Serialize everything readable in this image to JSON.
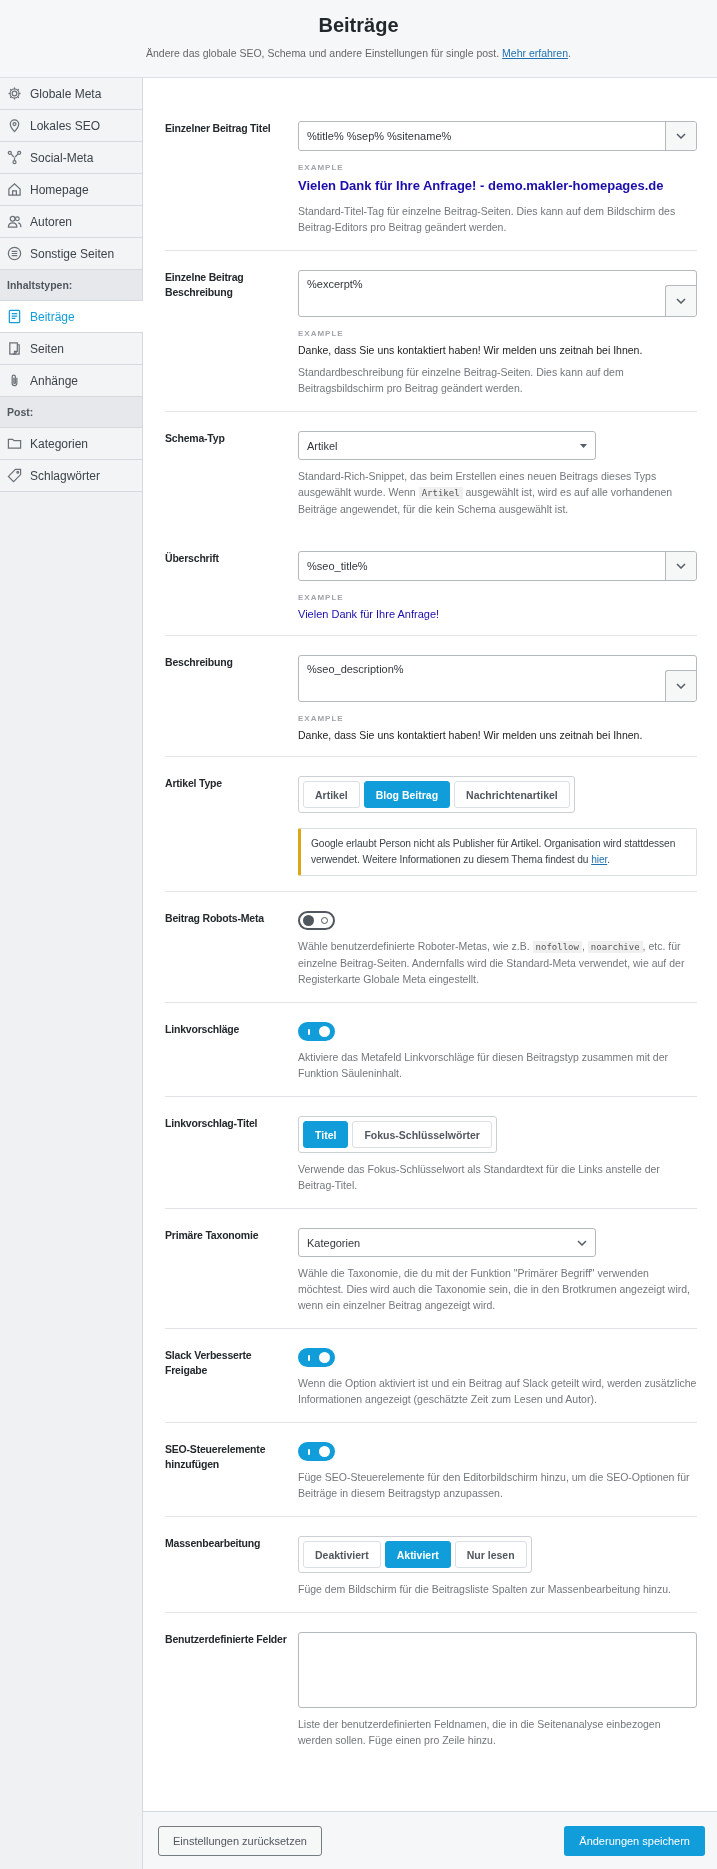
{
  "header": {
    "title": "Beiträge",
    "subtitle": [
      {
        "text": "Ändere das globale SEO, Schema und andere Einstellungen für single post. "
      },
      {
        "text": "Mehr erfahren",
        "link": true
      },
      {
        "text": "."
      }
    ]
  },
  "sidebar": {
    "items": [
      {
        "kind": "item",
        "label": "Globale Meta",
        "selected": false
      },
      {
        "kind": "item",
        "label": "Lokales SEO",
        "selected": false
      },
      {
        "kind": "item",
        "label": "Social-Meta",
        "selected": false
      },
      {
        "kind": "item",
        "label": "Homepage",
        "selected": false
      },
      {
        "kind": "item",
        "label": "Autoren",
        "selected": false
      },
      {
        "kind": "item",
        "label": "Sonstige Seiten",
        "selected": false
      },
      {
        "kind": "heading",
        "label": "Inhaltstypen:"
      },
      {
        "kind": "item",
        "label": "Beiträge",
        "selected": true
      },
      {
        "kind": "item",
        "label": "Seiten",
        "selected": false
      },
      {
        "kind": "item",
        "label": "Anhänge",
        "selected": false
      },
      {
        "kind": "heading",
        "label": "Post:"
      },
      {
        "kind": "item",
        "label": "Kategorien",
        "selected": false
      },
      {
        "kind": "item",
        "label": "Schlagwörter",
        "selected": false
      }
    ]
  },
  "settings": [
    {
      "kind": "template",
      "label": "Einzelner Beitrag Titel",
      "value": "%title% %sep% %sitename%",
      "multiline": false,
      "example_label": "EXAMPLE",
      "example": {
        "kind": "title",
        "text": "Vielen Dank für Ihre Anfrage! - demo.makler-homepages.de"
      },
      "description": [
        {
          "text": "Standard-Titel-Tag für einzelne Beitrag-Seiten. Dies kann auf dem Bildschirm des Beitrag-Editors pro Beitrag geändert werden."
        }
      ],
      "divider": true
    },
    {
      "kind": "template",
      "label": "Einzelne Beitrag Beschreibung",
      "value": "%excerpt%",
      "multiline": true,
      "example_label": "EXAMPLE",
      "example": {
        "kind": "snippet",
        "text": "Danke, dass Sie uns kontaktiert haben! Wir melden uns zeitnah bei Ihnen."
      },
      "description": [
        {
          "text": "Standardbeschreibung für einzelne Beitrag-Seiten. Dies kann auf dem Beitragsbildschirm pro Beitrag geändert werden."
        }
      ],
      "divider": true
    },
    {
      "kind": "select",
      "label": "Schema-Typ",
      "value": "Artikel",
      "description": [
        {
          "text": "Standard-Rich-Snippet, das beim Erstellen eines neuen Beitrags dieses Typs ausgewählt wurde. Wenn "
        },
        {
          "text": "Artikel",
          "code": true
        },
        {
          "text": " ausgewählt ist, wird es auf alle vorhandenen Beiträge angewendet, für die kein Schema ausgewählt ist."
        }
      ],
      "divider": false
    },
    {
      "kind": "template",
      "label": "Überschrift",
      "value": "%seo_title%",
      "multiline": false,
      "example_label": "EXAMPLE",
      "example": {
        "kind": "heading",
        "text": "Vielen Dank für Ihre Anfrage!"
      },
      "divider": true
    },
    {
      "kind": "template",
      "label": "Beschreibung",
      "value": "%seo_description%",
      "multiline": true,
      "example_label": "EXAMPLE",
      "example": {
        "kind": "snippet",
        "text": "Danke, dass Sie uns kontaktiert haben! Wir melden uns zeitnah bei Ihnen."
      },
      "divider": true
    },
    {
      "kind": "buttons",
      "label": "Artikel Type",
      "options": [
        {
          "label": "Artikel",
          "selected": false
        },
        {
          "label": "Blog Beitrag",
          "selected": true
        },
        {
          "label": "Nachrichtenartikel",
          "selected": false
        }
      ],
      "notice": [
        {
          "text": "Google erlaubt Person nicht als Publisher für Artikel. Organisation wird stattdessen verwendet. Weitere Informationen zu diesem Thema findest du "
        },
        {
          "text": "hier",
          "link": true
        },
        {
          "text": "."
        }
      ],
      "divider": true
    },
    {
      "kind": "toggle",
      "label": "Beitrag Robots-Meta",
      "on": false,
      "description": [
        {
          "text": "Wähle benutzerdefinierte Roboter-Metas, wie z.B. "
        },
        {
          "text": "nofollow",
          "code": true
        },
        {
          "text": ", "
        },
        {
          "text": "noarchive",
          "code": true
        },
        {
          "text": ", etc. für einzelne Beitrag-Seiten. Andernfalls wird die Standard-Meta verwendet, wie auf der Registerkarte Globale Meta eingestellt."
        }
      ],
      "divider": true
    },
    {
      "kind": "toggle",
      "label": "Linkvorschläge",
      "on": true,
      "description": [
        {
          "text": "Aktiviere das Metafeld Linkvorschläge für diesen Beitragstyp zusammen mit der Funktion Säuleninhalt."
        }
      ],
      "divider": true
    },
    {
      "kind": "buttons",
      "label": "Linkvorschlag-Titel",
      "options": [
        {
          "label": "Titel",
          "selected": true
        },
        {
          "label": "Fokus-Schlüsselwörter",
          "selected": false
        }
      ],
      "description": [
        {
          "text": "Verwende das Fokus-Schlüsselwort als Standardtext für die Links anstelle der Beitrag-Titel."
        }
      ],
      "divider": true
    },
    {
      "kind": "combobox",
      "label": "Primäre Taxonomie",
      "value": "Kategorien",
      "description": [
        {
          "text": "Wähle die Taxonomie, die du mit der Funktion \"Primärer Begriff\" verwenden möchtest. Dies wird auch die Taxonomie sein, die in den Brotkrumen angezeigt wird, wenn ein einzelner Beitrag angezeigt wird."
        }
      ],
      "divider": true
    },
    {
      "kind": "toggle",
      "label": "Slack Verbesserte Freigabe",
      "on": true,
      "description": [
        {
          "text": "Wenn die Option aktiviert ist und ein Beitrag auf Slack geteilt wird, werden zusätzliche Informationen angezeigt (geschätzte Zeit zum Lesen und Autor)."
        }
      ],
      "divider": true
    },
    {
      "kind": "toggle",
      "label": "SEO-Steuerelemente hinzufügen",
      "on": true,
      "description": [
        {
          "text": "Füge SEO-Steuerelemente für den Editorbildschirm hinzu, um die SEO-Optionen für Beiträge in diesem Beitragstyp anzupassen."
        }
      ],
      "divider": true
    },
    {
      "kind": "buttons",
      "label": "Massenbearbeitung",
      "options": [
        {
          "label": "Deaktiviert",
          "selected": false
        },
        {
          "label": "Aktiviert",
          "selected": true
        },
        {
          "label": "Nur lesen",
          "selected": false
        }
      ],
      "description": [
        {
          "text": "Füge dem Bildschirm für die Beitragsliste Spalten zur Massenbearbeitung hinzu."
        }
      ],
      "divider": true
    },
    {
      "kind": "textarea",
      "label": "Benutzerdefinierte Felder",
      "description": [
        {
          "text": "Liste der benutzerdefinierten Feldnamen, die in die Seitenanalyse einbezogen werden sollen. Füge einen pro Zeile hinzu."
        }
      ],
      "divider": false
    }
  ],
  "footer": {
    "reset_button": "Einstellungen zurücksetzen",
    "save_button": "Änderungen speichern"
  }
}
